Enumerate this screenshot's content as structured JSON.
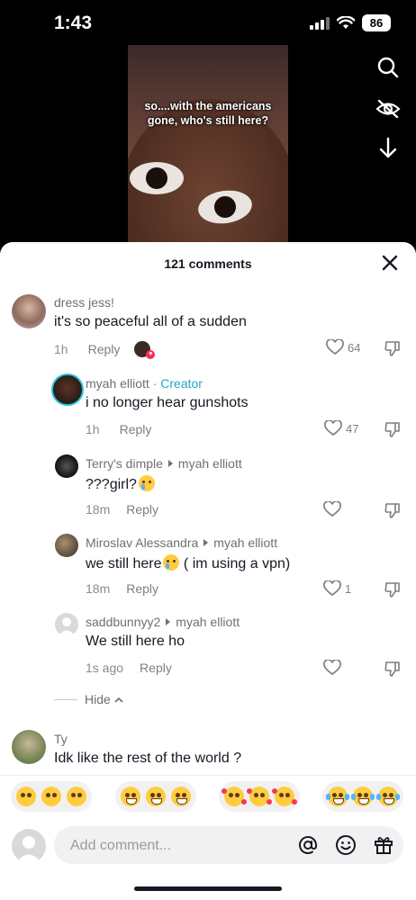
{
  "status": {
    "time": "1:43",
    "battery": "86"
  },
  "video": {
    "caption_line1": "so....with the americans",
    "caption_line2": "gone, who's still here?"
  },
  "comments_header": {
    "title": "121 comments"
  },
  "comments": [
    {
      "username": "dress jess!",
      "text": "it's so peaceful all of a sudden",
      "time": "1h",
      "reply": "Reply",
      "likes": "64"
    },
    {
      "username": "myah elliott",
      "badge": "· Creator",
      "text": "i no longer hear gunshots",
      "time": "1h",
      "reply": "Reply",
      "likes": "47"
    },
    {
      "username": "Terry's dimple",
      "reply_to": "myah elliott",
      "text": "???girl?",
      "time": "18m",
      "reply": "Reply",
      "likes": ""
    },
    {
      "username": "Miroslav Alessandra",
      "reply_to": "myah elliott",
      "text_before": "we still here",
      "text_after": " ( im using a vpn)",
      "time": "18m",
      "reply": "Reply",
      "likes": "1"
    },
    {
      "username": "saddbunnyy2",
      "reply_to": "myah elliott",
      "text": "We still here ho",
      "time": "1s ago",
      "reply": "Reply",
      "likes": ""
    },
    {
      "username": "Ty",
      "text": "Idk like the rest of the world ?"
    }
  ],
  "hide_label": "Hide",
  "input": {
    "placeholder": "Add comment..."
  },
  "colors": {
    "creator": "#20a9c2",
    "sheet_bg": "#ffffff",
    "text": "#161823",
    "muted": "#8a8b91"
  }
}
